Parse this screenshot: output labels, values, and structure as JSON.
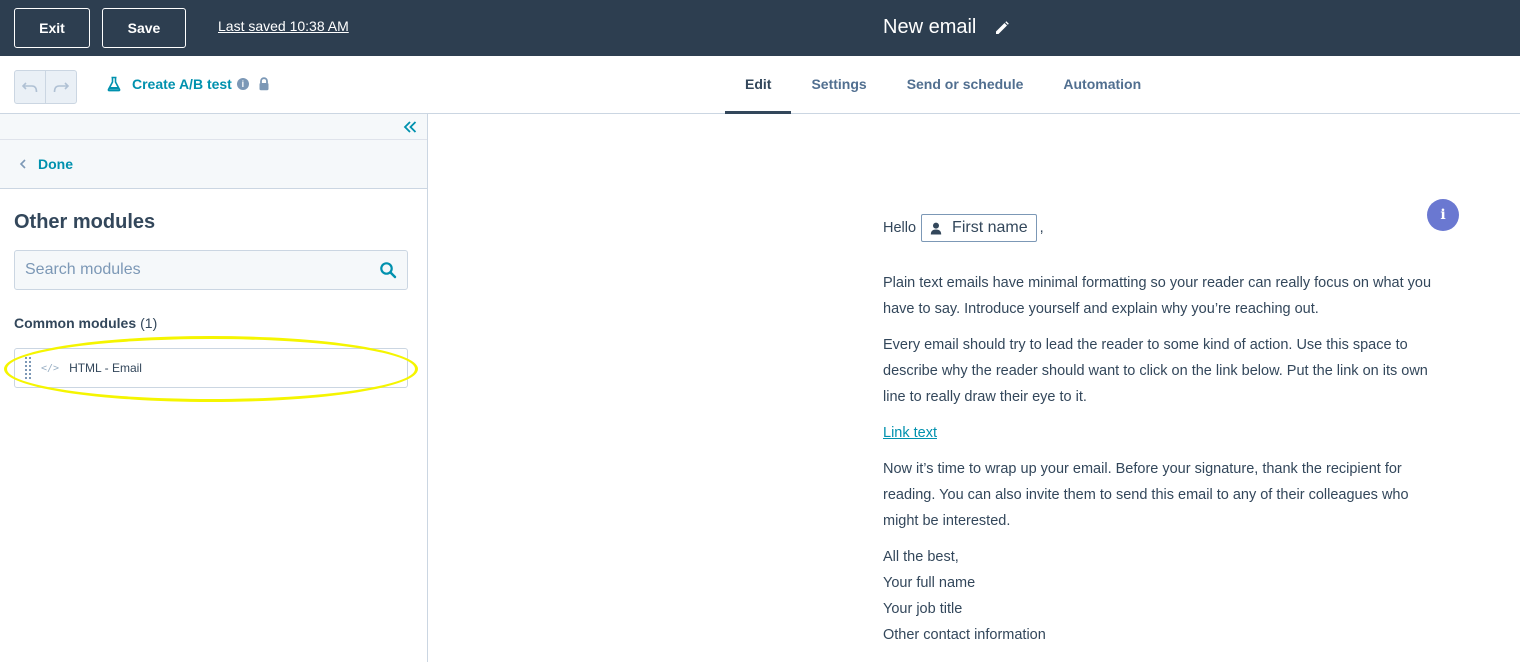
{
  "topbar": {
    "exit_label": "Exit",
    "save_label": "Save",
    "last_saved": "Last saved 10:38 AM",
    "title": "New email"
  },
  "navbar": {
    "ab_test_label": "Create A/B test",
    "info_icon_glyph": "i",
    "tabs": [
      {
        "label": "Edit",
        "active": true
      },
      {
        "label": "Settings",
        "active": false
      },
      {
        "label": "Send or schedule",
        "active": false
      },
      {
        "label": "Automation",
        "active": false
      }
    ]
  },
  "sidebar": {
    "done_label": "Done",
    "title": "Other modules",
    "search_placeholder": "Search modules",
    "common_heading": "Common modules",
    "common_count": "(1)",
    "modules": [
      {
        "icon": "code-icon",
        "icon_glyph": "</>",
        "label": "HTML - Email"
      }
    ],
    "highlight_color": "#f5f500"
  },
  "email": {
    "info_glyph": "i",
    "greeting": "Hello",
    "token_label": "First name",
    "comma": ",",
    "paragraphs": [
      "Plain text emails have minimal formatting so your reader can really focus on what you have to say. Introduce yourself and explain why you’re reaching out.",
      "Every email should try to lead the reader to some kind of action. Use this space to describe why the reader should want to click on the link below. Put the link on its own line to really draw their eye to it."
    ],
    "link_text": "Link text",
    "closing_paragraph": "Now it’s time to wrap up your email. Before your signature, thank the recipient for reading. You can also invite them to send this email to any of their colleagues who might be interested.",
    "signature": [
      "All the best,",
      "Your full name",
      "Your job title",
      "Other contact information"
    ]
  },
  "colors": {
    "topbar_bg": "#2d3e50",
    "accent": "#0091ae",
    "text": "#33475b",
    "info_bubble": "#6a78d1"
  }
}
